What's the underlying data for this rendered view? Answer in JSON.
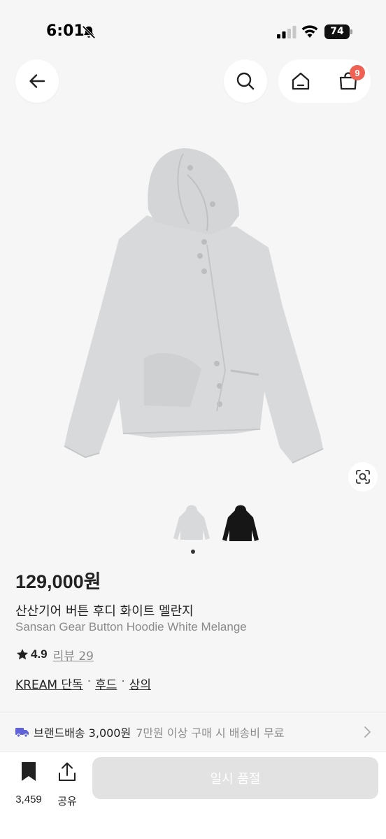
{
  "status_bar": {
    "time": "6:01",
    "battery": "74"
  },
  "header": {
    "cart_count": "9"
  },
  "product": {
    "price": "129,000원",
    "name_ko": "산산기어 버튼 후디 화이트 멜란지",
    "name_en": "Sansan Gear Button Hoodie White Melange",
    "rating": "4.9",
    "review_label": "리뷰 29",
    "tags": [
      "KREAM 단독",
      "후드",
      "상의"
    ],
    "tag_separator": "·"
  },
  "shipping": {
    "label": "브랜드배송 3,000원",
    "note": "7만원 이상 구매 시 배송비 무료"
  },
  "bottom_bar": {
    "bookmark_count": "3,459",
    "share_label": "공유",
    "cta_label": "일시 품절"
  },
  "colors": {
    "badge": "#ef6253",
    "cta_disabled": "#e2e2e2",
    "truck": "#5f62d8"
  },
  "icons": [
    "bell-off-icon",
    "signal-icon",
    "wifi-icon",
    "battery-icon",
    "back-arrow-icon",
    "search-icon",
    "home-icon",
    "shopping-bag-icon",
    "lens-icon",
    "star-icon",
    "truck-icon",
    "chevron-right-icon",
    "bookmark-icon",
    "share-icon"
  ]
}
